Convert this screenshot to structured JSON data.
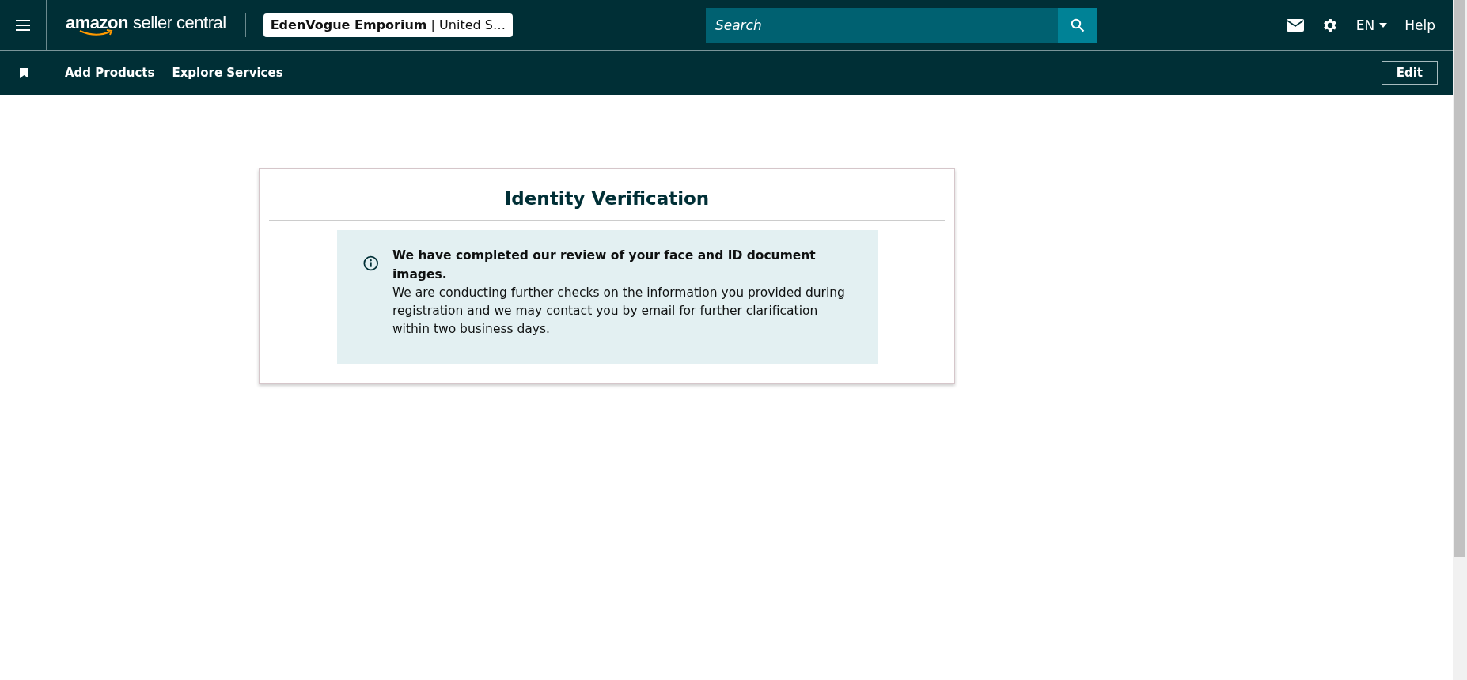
{
  "header": {
    "logo": {
      "brand": "amazon",
      "product": "seller central"
    },
    "store_selector": "**EdenVogue Emporium** | United S…",
    "search": {
      "placeholder": "Search"
    },
    "language": "EN",
    "help": "Help"
  },
  "nav": {
    "links": [
      "Add Products",
      "Explore Services"
    ],
    "edit_button": "Edit"
  },
  "card": {
    "title": "Identity Verification",
    "alert": {
      "heading": "We have completed our review of your face and ID document images.",
      "body": "We are conducting further checks on the information you provided during registration and we may contact you by email for further clarification within two business days."
    }
  }
}
